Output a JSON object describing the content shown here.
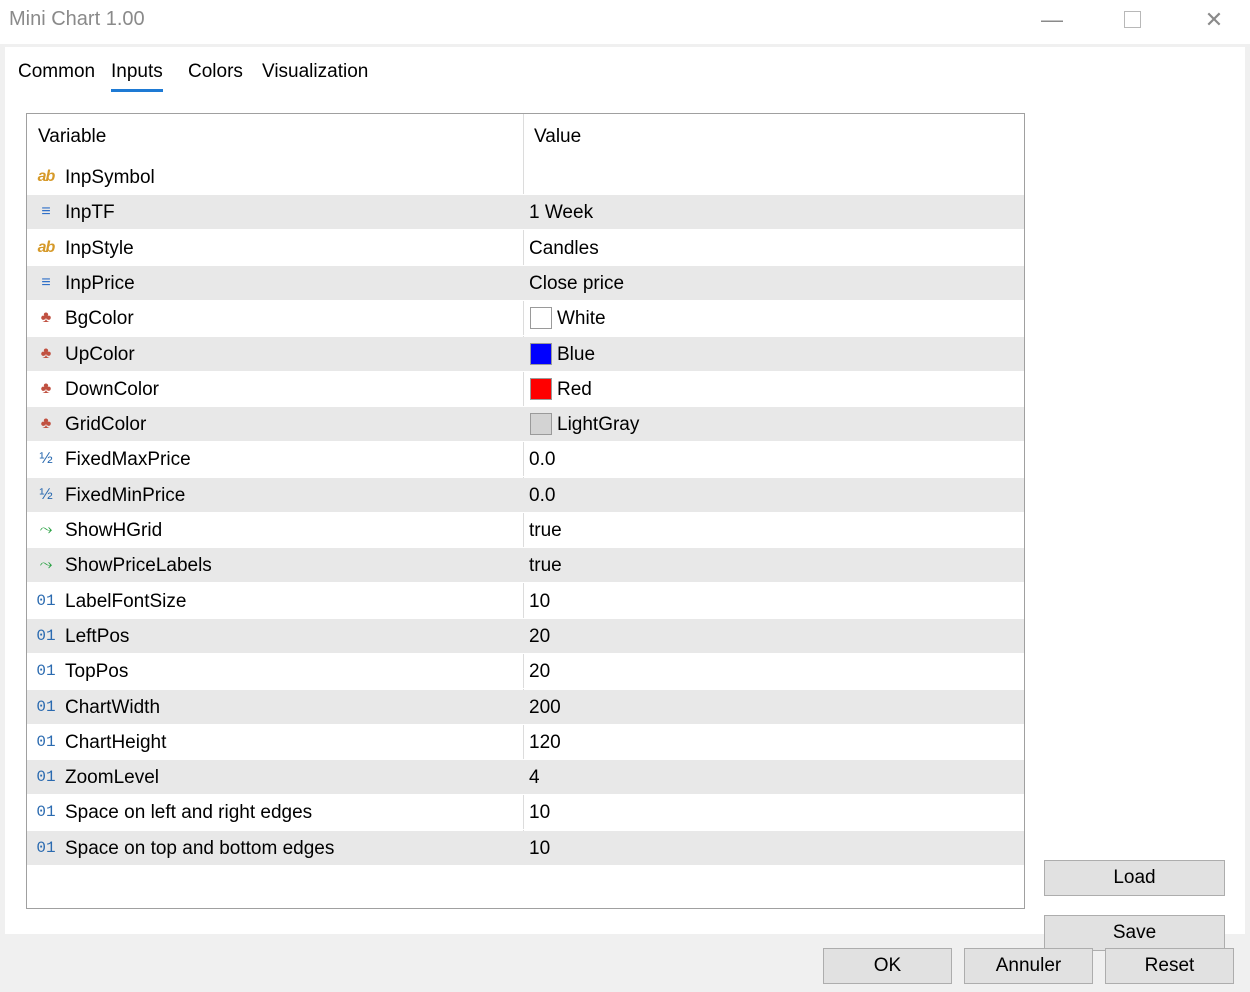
{
  "window": {
    "title": "Mini Chart 1.00"
  },
  "tabs": [
    {
      "label": "Common"
    },
    {
      "label": "Inputs"
    },
    {
      "label": "Colors"
    },
    {
      "label": "Visualization"
    }
  ],
  "active_tab": "Inputs",
  "grid": {
    "col_variable": "Variable",
    "col_value": "Value",
    "rows": [
      {
        "icon": "string-icon",
        "glyph": "ab",
        "name": "InpSymbol",
        "value": ""
      },
      {
        "icon": "enum-icon",
        "glyph": "≡",
        "name": "InpTF",
        "value": "1 Week"
      },
      {
        "icon": "string-icon",
        "glyph": "ab",
        "name": "InpStyle",
        "value": "Candles"
      },
      {
        "icon": "enum-icon",
        "glyph": "≡",
        "name": "InpPrice",
        "value": "Close price"
      },
      {
        "icon": "color-icon",
        "glyph": "♣",
        "name": "BgColor",
        "value": "White",
        "swatch": "#ffffff"
      },
      {
        "icon": "color-icon",
        "glyph": "♣",
        "name": "UpColor",
        "value": "Blue",
        "swatch": "#0000ff"
      },
      {
        "icon": "color-icon",
        "glyph": "♣",
        "name": "DownColor",
        "value": "Red",
        "swatch": "#ff0000"
      },
      {
        "icon": "color-icon",
        "glyph": "♣",
        "name": "GridColor",
        "value": "LightGray",
        "swatch": "#d3d3d3"
      },
      {
        "icon": "double-icon",
        "glyph": "½",
        "name": "FixedMaxPrice",
        "value": "0.0"
      },
      {
        "icon": "double-icon",
        "glyph": "½",
        "name": "FixedMinPrice",
        "value": "0.0"
      },
      {
        "icon": "bool-icon",
        "glyph": "⤳",
        "name": "ShowHGrid",
        "value": "true"
      },
      {
        "icon": "bool-icon",
        "glyph": "⤳",
        "name": "ShowPriceLabels",
        "value": "true"
      },
      {
        "icon": "int-icon",
        "glyph": "01",
        "name": "LabelFontSize",
        "value": "10"
      },
      {
        "icon": "int-icon",
        "glyph": "01",
        "name": "LeftPos",
        "value": "20"
      },
      {
        "icon": "int-icon",
        "glyph": "01",
        "name": "TopPos",
        "value": "20"
      },
      {
        "icon": "int-icon",
        "glyph": "01",
        "name": "ChartWidth",
        "value": "200"
      },
      {
        "icon": "int-icon",
        "glyph": "01",
        "name": "ChartHeight",
        "value": "120"
      },
      {
        "icon": "int-icon",
        "glyph": "01",
        "name": "ZoomLevel",
        "value": "4"
      },
      {
        "icon": "int-icon",
        "glyph": "01",
        "name": "Space on left and right edges",
        "value": "10"
      },
      {
        "icon": "int-icon",
        "glyph": "01",
        "name": "Space on top and bottom edges",
        "value": "10"
      }
    ]
  },
  "buttons": {
    "load": "Load",
    "save": "Save",
    "ok": "OK",
    "annuler": "Annuler",
    "reset": "Reset"
  },
  "colors": {
    "tab_accent": "#1e7ad4",
    "row_alt": "#e8e8e8"
  }
}
